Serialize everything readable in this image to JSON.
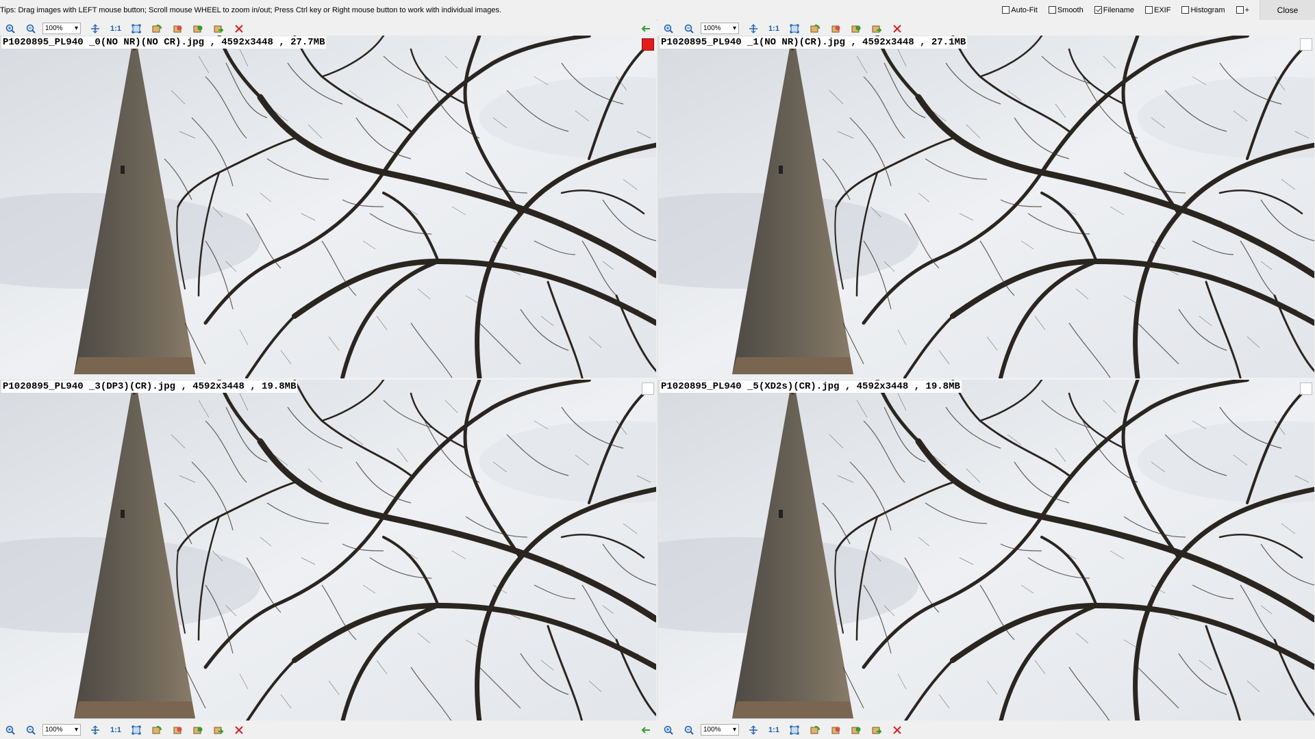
{
  "tips": "Tips: Drag images with LEFT mouse button; Scroll mouse WHEEL to zoom in/out; Press Ctrl key or Right mouse button to work with individual images.",
  "options": [
    {
      "label": "Auto-Fit",
      "checked": false
    },
    {
      "label": "Smooth",
      "checked": false
    },
    {
      "label": "Filename",
      "checked": true
    },
    {
      "label": "EXIF",
      "checked": false
    },
    {
      "label": "Histogram",
      "checked": false
    },
    {
      "label": "+",
      "checked": false
    }
  ],
  "close_label": "Close",
  "toolbar": {
    "zoom_value": "100%",
    "one_to_one": "1:1",
    "icons": [
      "zoom-in-icon",
      "zoom-out-icon",
      "fit-icon",
      "actual-size-icon",
      "full-screen-icon",
      "rotate-left-icon",
      "rotate-right-icon",
      "copy-icon",
      "save-icon",
      "close-icon"
    ]
  },
  "images": [
    {
      "caption": "P1020895_PL940 _0(NO NR)(NO CR).jpg , 4592x3448 , 27.7MB",
      "selected": true
    },
    {
      "caption": "P1020895_PL940 _1(NO NR)(CR).jpg , 4592x3448 , 27.1MB",
      "selected": false
    },
    {
      "caption": "P1020895_PL940 _3(DP3)(CR).jpg , 4592x3448 , 19.8MB",
      "selected": false
    },
    {
      "caption": "P1020895_PL940 _5(XD2s)(CR).jpg , 4592x3448 , 19.8MB",
      "selected": false
    }
  ],
  "colors": {
    "selected_marker": "#e51c1c",
    "accent": "#1d5ea8",
    "close_x": "#d42020",
    "arrow": "#2f9e2f"
  }
}
